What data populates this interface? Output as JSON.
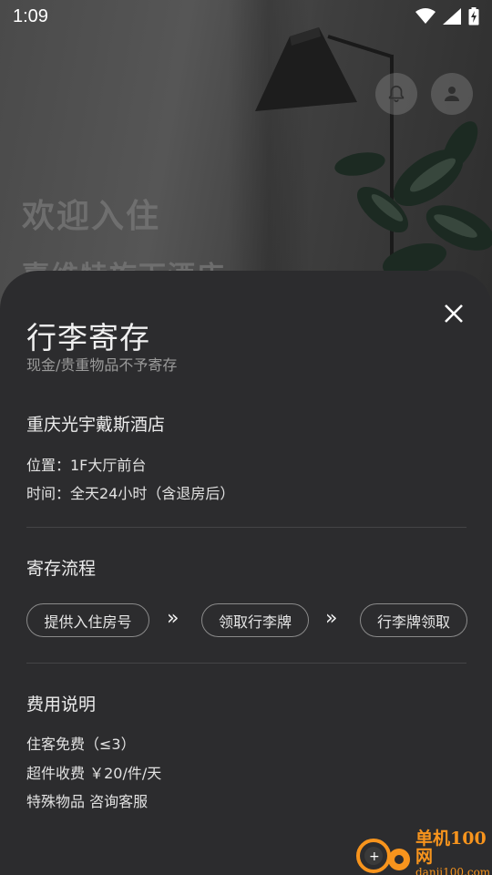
{
  "status_bar": {
    "time": "1:09",
    "icons": [
      "wifi-icon",
      "cellular-signal-icon",
      "battery-charging-icon"
    ]
  },
  "hero": {
    "title": "欢迎入住",
    "subtitle": "嘉维特旋下酒店",
    "buttons": [
      "bell-icon",
      "user-icon"
    ]
  },
  "sheet": {
    "title": "行李寄存",
    "subtitle": "现金/贵重物品不予寄存",
    "hotel_name": "重庆光宇戴斯酒店",
    "location": "位置：1F大厅前台",
    "hours": "时间：全天24小时（含退房后）",
    "process_heading": "寄存流程",
    "steps": [
      {
        "label": "提供入住房号"
      },
      {
        "label": "领取行李牌"
      },
      {
        "label": "行李牌领取"
      }
    ],
    "step_separator": "»",
    "fees_heading": "费用说明",
    "fees": [
      "住客免费（≤3）",
      "超件收费 ￥20/件/天",
      "特殊物品 咨询客服"
    ]
  },
  "watermark": {
    "name": "单机100网",
    "url": "danji100.com"
  },
  "colors": {
    "sheet_background": "#2c2c2e",
    "text_primary": "#ececec",
    "text_secondary": "#9a9a9a",
    "chip_border": "#8a8a8a",
    "watermark_orange": "#f7941d"
  }
}
